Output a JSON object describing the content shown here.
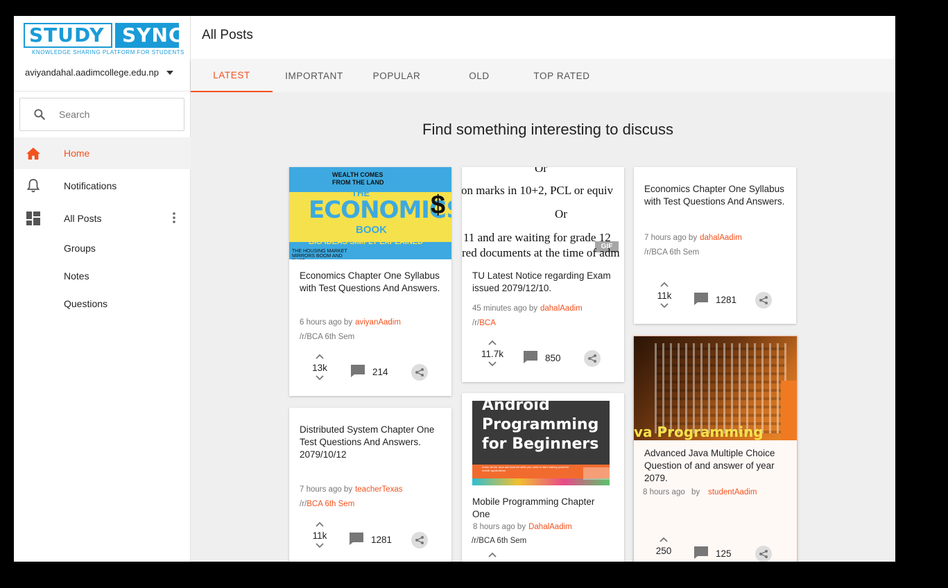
{
  "sidebar": {
    "logo": {
      "left": "STUDY",
      "right": "SYNC",
      "tagline": "KNOWLEDGE SHARING PLATFORM FOR STUDENTS"
    },
    "account": "aviyandahal.aadimcollege.edu.np",
    "search_placeholder": "Search",
    "nav": {
      "home": "Home",
      "notifications": "Notifications",
      "all_posts": "All Posts",
      "groups": "Groups",
      "notes": "Notes",
      "questions": "Questions"
    }
  },
  "header": {
    "title": "All Posts"
  },
  "tabs": [
    "LATEST",
    "IMPORTANT",
    "POPULAR",
    "OLD",
    "TOP RATED"
  ],
  "main": {
    "heading": "Find something interesting to discuss"
  },
  "colors": {
    "accent": "#f4511e",
    "brand": "#1a9bd7"
  },
  "thumbs": {
    "economics_book": {
      "line1": "WEALTH COMES",
      "line2": "FROM THE LAND",
      "title1": "THE",
      "title2": "ECONOMICS",
      "title3": "BOOK",
      "subtitle": "BIG IDEAS SIMPLY EXPLAINED",
      "caption_left": "THE HOUSING MARKET MIRRORS BOOM AND BUST"
    },
    "notice": {
      "l1": "Or",
      "l2": "on marks in 10+2, PCL or equiv",
      "l3": "Or",
      "l4": "11 and are waiting for grade 12",
      "l5": "red documents at the time of adm",
      "badge": "GIF"
    },
    "android": {
      "line1": "Android",
      "line2": "Programming",
      "line3": "for Beginners",
      "small": "Learn all the Java and Android skills you need to start making powerful mobile applications"
    },
    "java": {
      "caption": "va Programming"
    }
  },
  "posts": [
    {
      "title": "Economics Chapter One Syllabus with Test Questions And Answers.",
      "time": "6 hours ago by",
      "author": "aviyanAadim",
      "group": "/r/BCA 6th Sem",
      "votes": "13k",
      "comments": "214"
    },
    {
      "title": "TU Latest Notice regarding Exam issued 2079/12/10.",
      "time": "45 minutes ago by",
      "author": "dahalAadim",
      "group_prefix": "/r/",
      "group": "BCA",
      "votes": "11.7k",
      "comments": "850"
    },
    {
      "title": "Economics Chapter One Syllabus with Test Questions And Answers.",
      "time": "7 hours ago by",
      "author": "dahalAadim",
      "group": "/r/BCA 6th Sem",
      "votes": "11k",
      "comments": "1281"
    },
    {
      "title": "Distributed System Chapter One Test Questions And Answers. 2079/10/12",
      "time": "7 hours ago by",
      "author": "teacherTexas",
      "group_prefix": "/r/",
      "group": "BCA 6th Sem",
      "votes": "11k",
      "comments": "1281"
    },
    {
      "title": "Mobile Programming Chapter One",
      "time": "8 hours ago by",
      "author": "DahalAadim",
      "group": "/r/BCA 6th Sem"
    },
    {
      "title": "Advanced Java Multiple Choice Question of and answer of year 2079.",
      "time": "8 hours ago",
      "time_by": "by",
      "author": "studentAadim",
      "votes": "250",
      "comments": "125"
    }
  ]
}
